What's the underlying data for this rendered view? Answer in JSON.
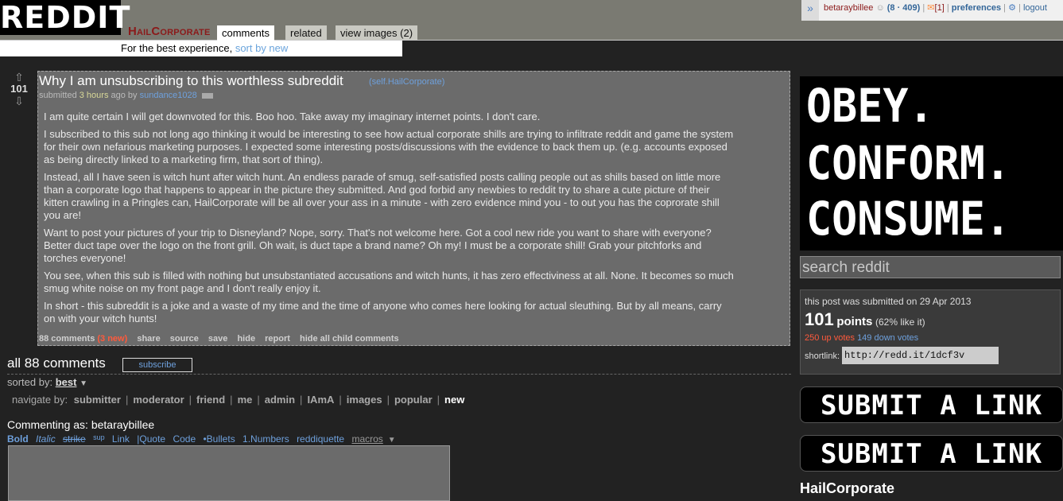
{
  "header": {
    "logo": "REDDIT",
    "subreddit": "HailCorporate",
    "tabs": [
      {
        "label": "comments",
        "active": true
      },
      {
        "label": "related",
        "active": false
      },
      {
        "label": "view images (2)",
        "active": false
      }
    ],
    "best_experience": "For the best experience, ",
    "sort_by_new": "sort by new"
  },
  "userbox": {
    "toggle": "»",
    "username": "betaraybillee",
    "karma": "(8 · 409)",
    "mail_count": "[1]",
    "preferences": "preferences",
    "logout": "logout"
  },
  "post": {
    "score": "101",
    "title": "Why I am unsubscribing to this worthless subreddit",
    "domain": "(self.HailCorporate)",
    "submitted_prefix": "submitted ",
    "time": "3 hours",
    "ago_by": " ago by ",
    "author": "sundance1028",
    "body": [
      "I am quite certain I will get downvoted for this. Boo hoo. Take away my imaginary internet points. I don't care.",
      "I subscribed to this sub not long ago thinking it would be interesting to see how actual corporate shills are trying to infiltrate reddit and game the system for their own nefarious marketing purposes. I expected some interesting posts/discussions with the evidence to back them up. (e.g. accounts exposed as being directly linked to a marketing firm, that sort of thing).",
      "Instead, all I have seen is witch hunt after witch hunt. An endless parade of smug, self-satisfied posts calling people out as shills based on little more than a corporate logo that happens to appear in the picture they submitted. And god forbid any newbies to reddit try to share a cute picture of their kitten crawling in a Pringles can, HailCorporate will be all over your ass in a minute - with zero evidence mind you - to out you has the coprorate shill you are!",
      "Want to post your pictures of your trip to Disneyland? Nope, sorry. That's not welcome here. Got a cool new ride you want to share with everyone? Better duct tape over the logo on the front grill. Oh wait, is duct tape a brand name? Oh my! I must be a corporate shill! Grab your pitchforks and torches everyone!",
      "You see, when this sub is filled with nothing but unsubstantiated accusations and witch hunts, it has zero effectiviness at all. None. It becomes so much smug white noise on my front page and I don't really enjoy it.",
      "In short - this subreddit is a joke and a waste of my time and the time of anyone who comes here looking for actual sleuthing. But by all means, carry on with your witch hunts!"
    ],
    "buttons": {
      "comments": "88 comments",
      "new": "(3 new)",
      "share": "share",
      "source": "source",
      "save": "save",
      "hide": "hide",
      "report": "report",
      "hide_children": "hide all child comments"
    }
  },
  "comments_area": {
    "all_comments": "all 88 comments",
    "subscribe": "subscribe",
    "sorted_by_label": "sorted by: ",
    "sorted_by_value": "best",
    "navigate_label": "navigate by:",
    "navigate_items": [
      "submitter",
      "moderator",
      "friend",
      "me",
      "admin",
      "IAmA",
      "images",
      "popular",
      "new"
    ],
    "commenting_as": "Commenting as: betaraybillee",
    "toolbar": {
      "bold": "Bold",
      "italic": "Italic",
      "strike": "strike",
      "sup": "sup",
      "link": "Link",
      "quote": "|Quote",
      "code": "Code",
      "bullets": "•Bullets",
      "numbers": "1.Numbers",
      "reddiquette": "reddiquette",
      "macros": "macros"
    }
  },
  "sidebar": {
    "banner_lines": [
      "OBEY.",
      "CONFORM.",
      "CONSUME."
    ],
    "search_placeholder": "search reddit",
    "submitted_on": "this post was submitted on 29 Apr 2013",
    "points_num": "101",
    "points_label": "points",
    "points_pct": "(62% like it)",
    "up_votes": "250 up votes",
    "down_votes": "149 down votes",
    "shortlink_label": "shortlink:",
    "shortlink": "http://redd.it/1dcf3v",
    "submit_link_1": "SUBMIT A LINK",
    "submit_link_2": "SUBMIT A LINK",
    "subreddit_title": "HailCorporate"
  },
  "colors": {
    "background": "#222222",
    "post_bg": "#6b6b6b",
    "link_blue": "#6ea0dc",
    "orange_red": "#ff5a3c",
    "subreddit_red": "#8b1a1a"
  }
}
